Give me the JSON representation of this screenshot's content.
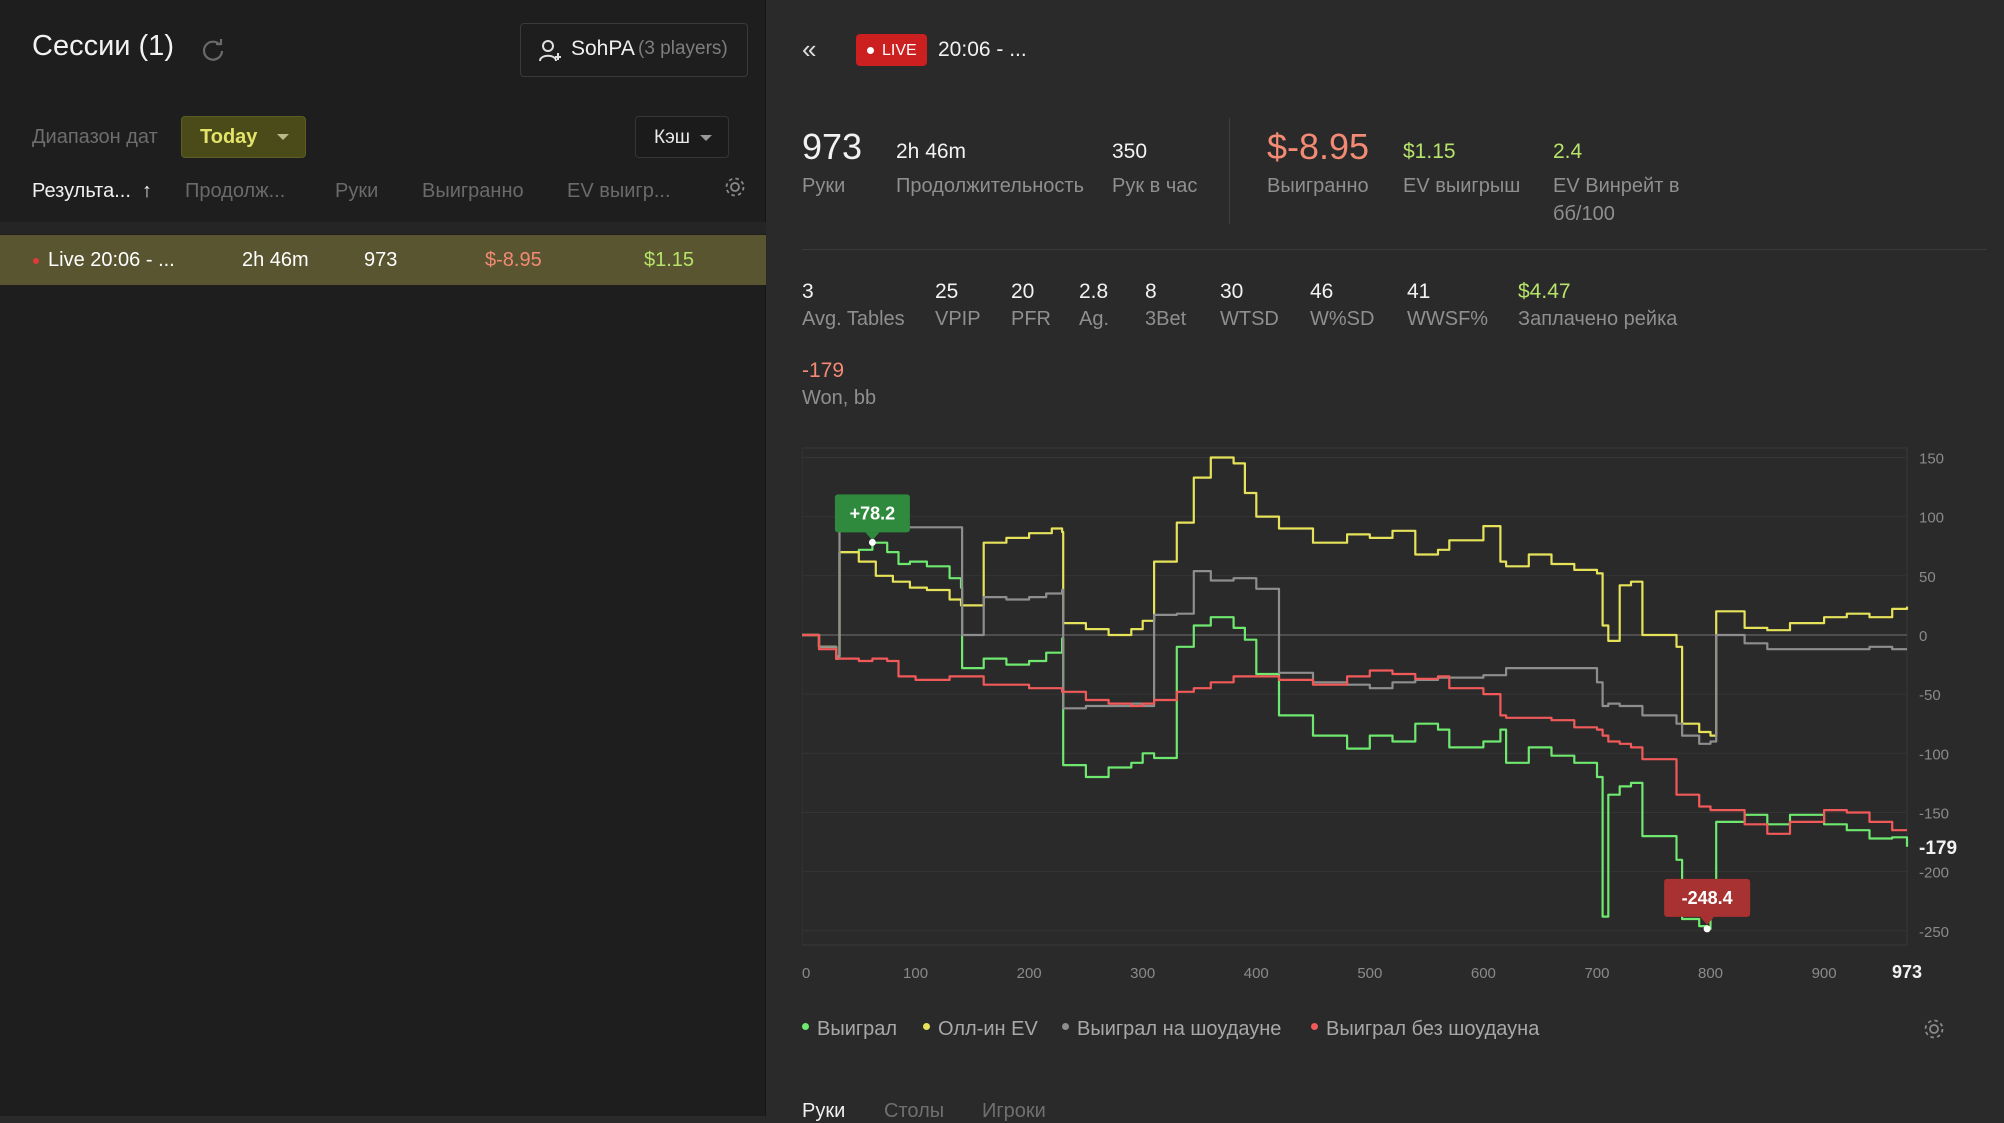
{
  "left": {
    "title": "Сессии (1)",
    "player": {
      "name": "SohPA",
      "count": "(3 players)"
    },
    "range_label": "Диапазон дат",
    "range_value": "Today",
    "game_type": "Кэш",
    "columns": [
      "Результа...",
      "Продолж...",
      "Руки",
      "Выигранно",
      "EV выигр..."
    ],
    "sort_arrow": "↑",
    "rows": [
      {
        "name": "Live 20:06 - ...",
        "duration": "2h 46m",
        "hands": "973",
        "won": "$-8.95",
        "ev": "$1.15"
      }
    ]
  },
  "session": {
    "back": "«",
    "live": "LIVE",
    "title": "20:06 - ..."
  },
  "stats_top": [
    {
      "value": "973",
      "label": "Руки"
    },
    {
      "value": "2h 46m",
      "label": "Продолжительность"
    },
    {
      "value": "350",
      "label": "Рук в час"
    },
    {
      "value": "$-8.95",
      "label": "Выигранно"
    },
    {
      "value": "$1.15",
      "label": "EV выигрыш"
    },
    {
      "value": "2.4",
      "label": "EV Винрейт в",
      "label2": "бб/100"
    }
  ],
  "stats_bottom": [
    {
      "value": "3",
      "label": "Avg. Tables"
    },
    {
      "value": "25",
      "label": "VPIP"
    },
    {
      "value": "20",
      "label": "PFR"
    },
    {
      "value": "2.8",
      "label": "Ag."
    },
    {
      "value": "8",
      "label": "3Bet"
    },
    {
      "value": "30",
      "label": "WTSD"
    },
    {
      "value": "46",
      "label": "W%SD"
    },
    {
      "value": "41",
      "label": "WWSF%"
    },
    {
      "value": "$4.47",
      "label": "Заплачено рейка"
    }
  ],
  "won_bb": {
    "value": "-179",
    "label": "Won, bb"
  },
  "legend": [
    "Выиграл",
    "Олл-ин EV",
    "Выиграл на шоудауне",
    "Выиграл без шоудауна"
  ],
  "tabs": [
    "Руки",
    "Столы",
    "Игроки"
  ],
  "colors": {
    "won": "#6ee86e",
    "allin_ev": "#e6e35a",
    "showdown": "#8e8e8e",
    "no_showdown": "#f25a5a",
    "accent_green": "#b6e36a",
    "accent_red": "#f28a74",
    "live_red": "#cc1f1f"
  },
  "chart_data": {
    "type": "line",
    "xlim": [
      0,
      973
    ],
    "ylim": [
      -262,
      158
    ],
    "x_ticks": [
      0,
      100,
      200,
      300,
      400,
      500,
      600,
      700,
      800,
      900
    ],
    "x_end_label": "973",
    "y_ticks": [
      150,
      100,
      50,
      0,
      -50,
      -100,
      -150,
      -200,
      -250
    ],
    "end_value_label": "-179",
    "annotations": [
      {
        "text": "+78.2",
        "x": 62,
        "y": 78.2,
        "style": "max"
      },
      {
        "text": "-248.4",
        "x": 797,
        "y": -248.4,
        "style": "min"
      }
    ],
    "grid": true,
    "series": [
      {
        "name": "Выиграл",
        "color": "#6ee86e",
        "points": [
          [
            0,
            0
          ],
          [
            15,
            -10
          ],
          [
            30,
            -20
          ],
          [
            32,
            -18
          ],
          [
            33,
            70
          ],
          [
            50,
            72
          ],
          [
            62,
            78
          ],
          [
            75,
            70
          ],
          [
            85,
            60
          ],
          [
            95,
            62
          ],
          [
            110,
            58
          ],
          [
            130,
            48
          ],
          [
            140,
            40
          ],
          [
            141,
            -28
          ],
          [
            160,
            -20
          ],
          [
            180,
            -25
          ],
          [
            200,
            -22
          ],
          [
            215,
            -15
          ],
          [
            229,
            -3
          ],
          [
            230,
            -110
          ],
          [
            250,
            -120
          ],
          [
            270,
            -112
          ],
          [
            290,
            -108
          ],
          [
            300,
            -100
          ],
          [
            310,
            -104
          ],
          [
            330,
            -10
          ],
          [
            345,
            8
          ],
          [
            360,
            15
          ],
          [
            380,
            6
          ],
          [
            390,
            -4
          ],
          [
            400,
            -33
          ],
          [
            420,
            -68
          ],
          [
            450,
            -85
          ],
          [
            480,
            -96
          ],
          [
            500,
            -85
          ],
          [
            520,
            -90
          ],
          [
            540,
            -75
          ],
          [
            560,
            -80
          ],
          [
            570,
            -95
          ],
          [
            600,
            -90
          ],
          [
            615,
            -80
          ],
          [
            620,
            -108
          ],
          [
            640,
            -95
          ],
          [
            660,
            -102
          ],
          [
            680,
            -108
          ],
          [
            700,
            -120
          ],
          [
            705,
            -238
          ],
          [
            710,
            -135
          ],
          [
            720,
            -128
          ],
          [
            730,
            -125
          ],
          [
            740,
            -170
          ],
          [
            770,
            -190
          ],
          [
            775,
            -240
          ],
          [
            790,
            -246
          ],
          [
            797,
            -248.4
          ],
          [
            800,
            -220
          ],
          [
            805,
            -158
          ],
          [
            830,
            -152
          ],
          [
            850,
            -160
          ],
          [
            870,
            -152
          ],
          [
            900,
            -160
          ],
          [
            920,
            -165
          ],
          [
            940,
            -172
          ],
          [
            960,
            -171
          ],
          [
            973,
            -179
          ]
        ]
      },
      {
        "name": "Олл-ин EV",
        "color": "#e6e35a",
        "points": [
          [
            0,
            0
          ],
          [
            15,
            -10
          ],
          [
            30,
            -20
          ],
          [
            32,
            -18
          ],
          [
            33,
            70
          ],
          [
            50,
            62
          ],
          [
            65,
            50
          ],
          [
            80,
            45
          ],
          [
            95,
            40
          ],
          [
            110,
            38
          ],
          [
            130,
            30
          ],
          [
            140,
            25
          ],
          [
            160,
            78
          ],
          [
            180,
            82
          ],
          [
            200,
            86
          ],
          [
            220,
            90
          ],
          [
            229,
            87
          ],
          [
            230,
            10
          ],
          [
            250,
            5
          ],
          [
            270,
            0
          ],
          [
            290,
            5
          ],
          [
            300,
            12
          ],
          [
            310,
            62
          ],
          [
            330,
            95
          ],
          [
            345,
            133
          ],
          [
            360,
            150
          ],
          [
            380,
            145
          ],
          [
            390,
            120
          ],
          [
            400,
            100
          ],
          [
            420,
            90
          ],
          [
            450,
            78
          ],
          [
            480,
            85
          ],
          [
            500,
            82
          ],
          [
            520,
            88
          ],
          [
            540,
            68
          ],
          [
            560,
            72
          ],
          [
            570,
            80
          ],
          [
            600,
            92
          ],
          [
            615,
            62
          ],
          [
            620,
            58
          ],
          [
            640,
            68
          ],
          [
            660,
            60
          ],
          [
            680,
            55
          ],
          [
            700,
            52
          ],
          [
            705,
            8
          ],
          [
            710,
            -5
          ],
          [
            720,
            42
          ],
          [
            730,
            45
          ],
          [
            740,
            0
          ],
          [
            770,
            -10
          ],
          [
            775,
            -75
          ],
          [
            790,
            -82
          ],
          [
            800,
            -85
          ],
          [
            805,
            20
          ],
          [
            830,
            6
          ],
          [
            850,
            4
          ],
          [
            870,
            10
          ],
          [
            900,
            15
          ],
          [
            920,
            18
          ],
          [
            940,
            15
          ],
          [
            960,
            22
          ],
          [
            973,
            24
          ]
        ]
      },
      {
        "name": "Выиграл на шоудауне",
        "color": "#8e8e8e",
        "points": [
          [
            0,
            0
          ],
          [
            15,
            -10
          ],
          [
            30,
            -20
          ],
          [
            32,
            -18
          ],
          [
            33,
            90
          ],
          [
            62,
            92
          ],
          [
            80,
            91
          ],
          [
            140,
            91
          ],
          [
            141,
            0
          ],
          [
            160,
            32
          ],
          [
            180,
            30
          ],
          [
            200,
            32
          ],
          [
            215,
            35
          ],
          [
            229,
            38
          ],
          [
            230,
            -62
          ],
          [
            250,
            -60
          ],
          [
            270,
            -60
          ],
          [
            290,
            -58
          ],
          [
            300,
            -60
          ],
          [
            310,
            17
          ],
          [
            330,
            18
          ],
          [
            345,
            54
          ],
          [
            360,
            46
          ],
          [
            380,
            48
          ],
          [
            400,
            39
          ],
          [
            420,
            -32
          ],
          [
            450,
            -40
          ],
          [
            480,
            -42
          ],
          [
            500,
            -45
          ],
          [
            520,
            -40
          ],
          [
            540,
            -38
          ],
          [
            560,
            -36
          ],
          [
            570,
            -36
          ],
          [
            600,
            -34
          ],
          [
            615,
            -34
          ],
          [
            620,
            -28
          ],
          [
            640,
            -28
          ],
          [
            660,
            -28
          ],
          [
            680,
            -28
          ],
          [
            700,
            -40
          ],
          [
            705,
            -60
          ],
          [
            710,
            -58
          ],
          [
            720,
            -60
          ],
          [
            730,
            -60
          ],
          [
            740,
            -68
          ],
          [
            770,
            -75
          ],
          [
            775,
            -85
          ],
          [
            790,
            -92
          ],
          [
            800,
            -90
          ],
          [
            805,
            0
          ],
          [
            830,
            -7
          ],
          [
            850,
            -12
          ],
          [
            870,
            -12
          ],
          [
            900,
            -12
          ],
          [
            920,
            -12
          ],
          [
            940,
            -10
          ],
          [
            960,
            -12
          ],
          [
            973,
            -12
          ]
        ]
      },
      {
        "name": "Выиграл без шоудауна",
        "color": "#f25a5a",
        "points": [
          [
            0,
            0
          ],
          [
            15,
            -12
          ],
          [
            30,
            -20
          ],
          [
            50,
            -22
          ],
          [
            62,
            -20
          ],
          [
            75,
            -22
          ],
          [
            85,
            -35
          ],
          [
            100,
            -38
          ],
          [
            130,
            -35
          ],
          [
            160,
            -42
          ],
          [
            200,
            -45
          ],
          [
            229,
            -48
          ],
          [
            250,
            -55
          ],
          [
            270,
            -58
          ],
          [
            290,
            -60
          ],
          [
            300,
            -58
          ],
          [
            310,
            -55
          ],
          [
            330,
            -48
          ],
          [
            345,
            -45
          ],
          [
            360,
            -40
          ],
          [
            380,
            -35
          ],
          [
            400,
            -35
          ],
          [
            420,
            -38
          ],
          [
            450,
            -42
          ],
          [
            480,
            -35
          ],
          [
            500,
            -30
          ],
          [
            520,
            -33
          ],
          [
            540,
            -37
          ],
          [
            560,
            -35
          ],
          [
            570,
            -45
          ],
          [
            600,
            -50
          ],
          [
            615,
            -68
          ],
          [
            620,
            -70
          ],
          [
            640,
            -70
          ],
          [
            660,
            -72
          ],
          [
            680,
            -78
          ],
          [
            700,
            -80
          ],
          [
            705,
            -85
          ],
          [
            710,
            -90
          ],
          [
            720,
            -92
          ],
          [
            730,
            -95
          ],
          [
            740,
            -105
          ],
          [
            770,
            -135
          ],
          [
            790,
            -145
          ],
          [
            800,
            -148
          ],
          [
            830,
            -160
          ],
          [
            850,
            -168
          ],
          [
            870,
            -158
          ],
          [
            900,
            -148
          ],
          [
            920,
            -150
          ],
          [
            940,
            -158
          ],
          [
            960,
            -165
          ],
          [
            973,
            -165
          ]
        ]
      }
    ]
  }
}
